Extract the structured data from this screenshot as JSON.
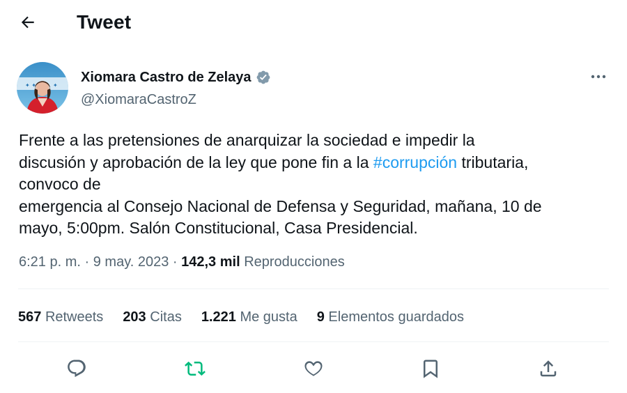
{
  "header": {
    "title": "Tweet",
    "back_icon": "arrow-left-icon"
  },
  "author": {
    "display_name": "Xiomara Castro de Zelaya",
    "handle": "@XiomaraCastroZ",
    "verified": true,
    "verified_color": "#829aab"
  },
  "tweet": {
    "text_lines": [
      [
        "Frente a las pretensiones de anarquizar la sociedad e impedir la"
      ],
      [
        "discusión y aprobación de la ley que pone fin a la ",
        "#corrupción",
        " tributaria,"
      ],
      [
        "convoco de"
      ],
      [
        "emergencia al Consejo Nacional de Defensa y Seguridad, mañana, 10 de"
      ],
      [
        "mayo, 5:00pm. Salón Constitucional, Casa Presidencial."
      ]
    ],
    "line1": "Frente a las pretensiones de anarquizar la sociedad e impedir la",
    "line2_before": "discusión y aprobación de la ley que pone fin a la ",
    "hashtag": "#corrupción",
    "line2_after": " tributaria,",
    "line3": "convoco de",
    "line4": "emergencia al Consejo Nacional de Defensa y Seguridad, mañana, 10 de",
    "line5": "mayo, 5:00pm. Salón Constitucional, Casa Presidencial.",
    "hashtag_color": "#1d9bf0"
  },
  "meta": {
    "time": "6:21 p. m.",
    "separator": "·",
    "date": "9 may. 2023",
    "views_count": "142,3 mil",
    "views_label": "Reproducciones"
  },
  "stats": {
    "retweets_count": "567",
    "retweets_label": "Retweets",
    "quotes_count": "203",
    "quotes_label": "Citas",
    "likes_count": "1.221",
    "likes_label": "Me gusta",
    "bookmarks_count": "9",
    "bookmarks_label": "Elementos guardados"
  },
  "actions": [
    {
      "name": "reply",
      "icon": "reply-icon"
    },
    {
      "name": "retweet",
      "icon": "retweet-icon",
      "color": "#00ba7c"
    },
    {
      "name": "like",
      "icon": "heart-icon"
    },
    {
      "name": "bookmark",
      "icon": "bookmark-icon"
    },
    {
      "name": "share",
      "icon": "share-icon"
    }
  ],
  "colors": {
    "text": "#0f1419",
    "secondary": "#536471",
    "divider": "#eff3f4"
  }
}
